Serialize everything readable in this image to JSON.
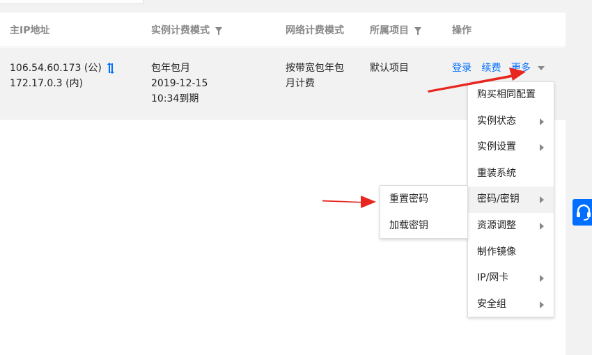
{
  "table": {
    "headers": {
      "ip": "主IP地址",
      "billing": "实例计费模式",
      "network": "网络计费模式",
      "project": "所属项目",
      "actions": "操作"
    },
    "row": {
      "public_ip": "106.54.60.173 (公)",
      "private_ip": "172.17.0.3 (内)",
      "billing_line1": "包年包月",
      "billing_line2": "2019-12-15",
      "billing_line3": "10:34到期",
      "network_line1": "按带宽包年包",
      "network_line2": "月计费",
      "project": "默认项目",
      "action_login": "登录",
      "action_renew": "续费",
      "action_more": "更多"
    }
  },
  "more_menu": {
    "items": [
      "购买相同配置",
      "实例状态",
      "实例设置",
      "重装系统",
      "密码/密钥",
      "资源调整",
      "制作镜像",
      "IP/网卡",
      "安全组"
    ],
    "active_index": 4
  },
  "submenu": {
    "items": [
      "重置密码",
      "加载密钥"
    ]
  },
  "colors": {
    "link": "#006eff",
    "annotation_arrow": "#e8261f",
    "row_background": "#f2f2f2"
  }
}
